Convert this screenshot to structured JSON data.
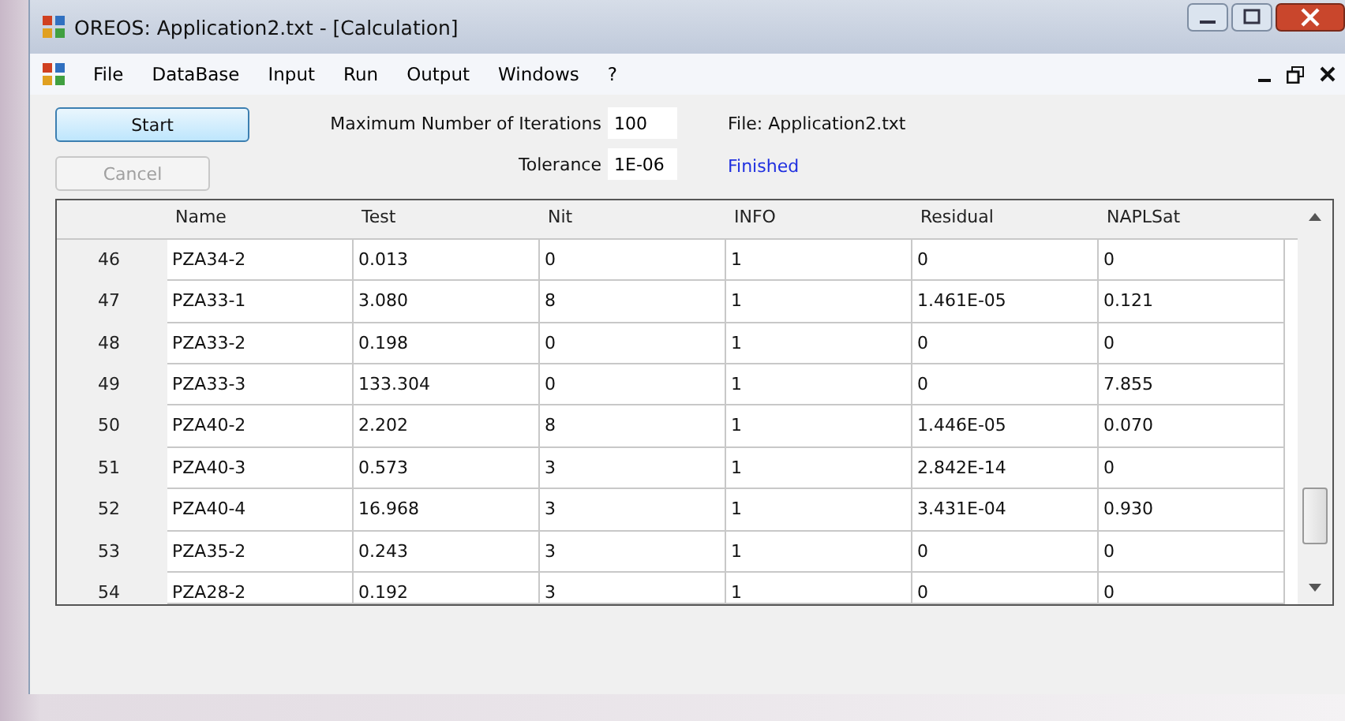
{
  "window": {
    "title": "OREOS: Application2.txt - [Calculation]"
  },
  "menu": [
    "File",
    "DataBase",
    "Input",
    "Run",
    "Output",
    "Windows",
    "?"
  ],
  "buttons": [
    {
      "label": "Start",
      "disabled": false
    },
    {
      "label": "Cancel",
      "disabled": true
    }
  ],
  "fields": [
    {
      "label": "Maximum Number of Iterations",
      "value": "100"
    },
    {
      "label": "Tolerance",
      "value": "1E-06"
    }
  ],
  "file_label": "File: Application2.txt",
  "status": "Finished",
  "table": {
    "columns": [
      "Name",
      "Test",
      "Nit",
      "INFO",
      "Residual",
      "NAPLSat"
    ],
    "rows": [
      {
        "number": "46",
        "cells": [
          "PZA34-2",
          "0.013",
          "0",
          "1",
          "0",
          "0"
        ]
      },
      {
        "number": "47",
        "cells": [
          "PZA33-1",
          "3.080",
          "8",
          "1",
          "1.461E-05",
          "0.121"
        ]
      },
      {
        "number": "48",
        "cells": [
          "PZA33-2",
          "0.198",
          "0",
          "1",
          "0",
          "0"
        ]
      },
      {
        "number": "49",
        "cells": [
          "PZA33-3",
          "133.304",
          "0",
          "1",
          "0",
          "7.855"
        ]
      },
      {
        "number": "50",
        "cells": [
          "PZA40-2",
          "2.202",
          "8",
          "1",
          "1.446E-05",
          "0.070"
        ]
      },
      {
        "number": "51",
        "cells": [
          "PZA40-3",
          "0.573",
          "3",
          "1",
          "2.842E-14",
          "0"
        ]
      },
      {
        "number": "52",
        "cells": [
          "PZA40-4",
          "16.968",
          "3",
          "1",
          "3.431E-04",
          "0.930"
        ]
      },
      {
        "number": "53",
        "cells": [
          "PZA35-2",
          "0.243",
          "3",
          "1",
          "0",
          "0"
        ]
      },
      {
        "number": "54",
        "cells": [
          "PZA28-2",
          "0.192",
          "3",
          "1",
          "0",
          "0"
        ]
      }
    ]
  }
}
